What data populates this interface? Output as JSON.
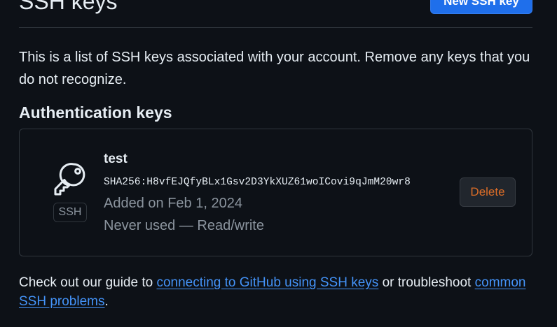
{
  "header": {
    "title": "SSH keys",
    "new_button_label": "New SSH key"
  },
  "intro": "This is a list of SSH keys associated with your account. Remove any keys that you do not recognize.",
  "section": {
    "heading": "Authentication keys"
  },
  "keys": [
    {
      "icon": "key-icon",
      "type_label": "SSH",
      "name": "test",
      "fingerprint": "SHA256:H8vfEJQfyBLx1Gsv2D3YkXUZ61woICovi9qJmM20wr8",
      "added": "Added on Feb 1, 2024",
      "usage": "Never used — Read/write",
      "delete_label": "Delete"
    }
  ],
  "footer": {
    "prefix": "Check out our guide to ",
    "link1": "connecting to GitHub using SSH keys",
    "middle": " or troubleshoot ",
    "link2": "common SSH problems",
    "suffix": "."
  },
  "colors": {
    "background": "#0d1117",
    "text": "#e6edf3",
    "muted": "#8b949e",
    "border": "#30363d",
    "primary_button": "#1f6feb",
    "danger_text": "#db6d28",
    "link": "#4493f8"
  }
}
